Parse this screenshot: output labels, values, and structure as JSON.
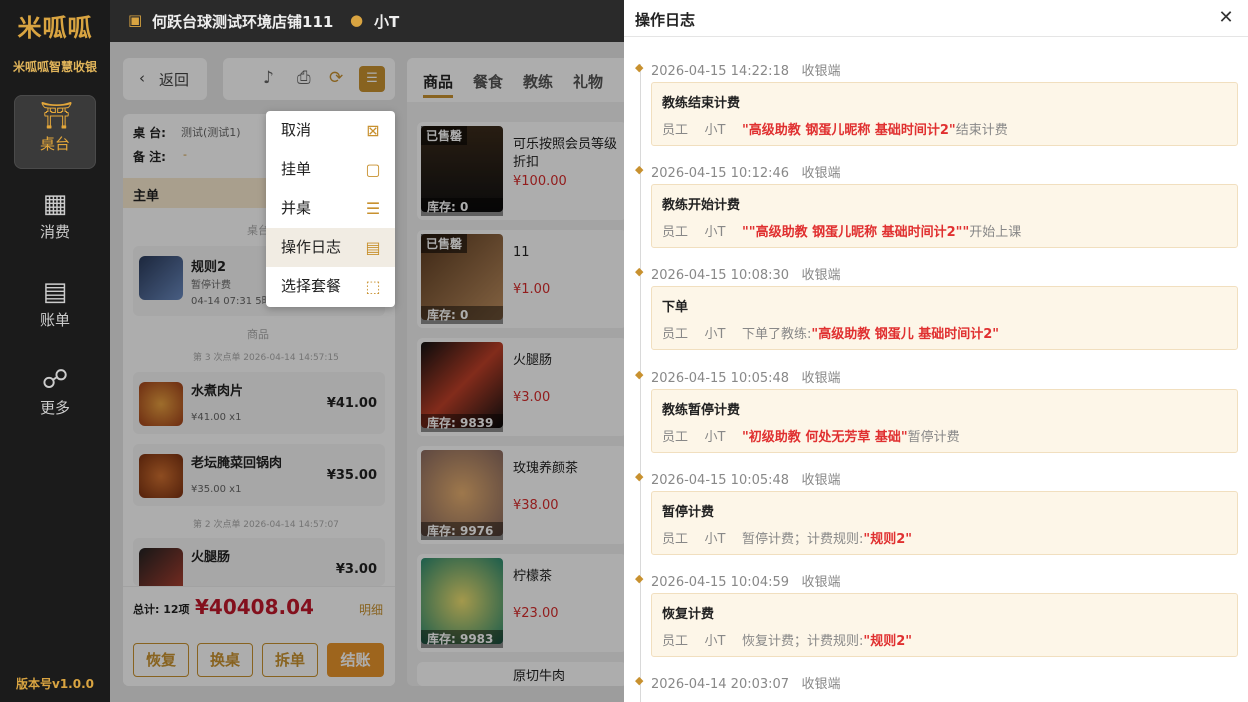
{
  "app": {
    "logo": "米呱呱",
    "brand": "米呱呱智慧收银",
    "version": "版本号v1.0.0"
  },
  "nav": [
    {
      "label": "桌台"
    },
    {
      "label": "消费"
    },
    {
      "label": "账单"
    },
    {
      "label": "更多"
    }
  ],
  "topbar": {
    "store": "何跃台球测试环境店铺111",
    "user": "小T"
  },
  "left": {
    "back": "返回",
    "table_label": "桌 台:",
    "table_value": "测试(测试1)",
    "note_label": "备 注:",
    "note_value": "-",
    "main_order": "主单",
    "sec_table": "桌台",
    "sec_goods": "商品",
    "rule_name": "规则2",
    "rule_status": "暂停计费",
    "rule_time": "04-14 07:31 5时",
    "batch3": "第 3 次点单 2026-04-14 14:57:15",
    "batch2": "第 2 次点单 2026-04-14 14:57:07",
    "dishes": [
      {
        "name": "水煮肉片",
        "sub": "¥41.00 x1",
        "price": "¥41.00"
      },
      {
        "name": "老坛腌菜回锅肉",
        "sub": "¥35.00 x1",
        "price": "¥35.00"
      },
      {
        "name": "火腿肠",
        "sub": "",
        "price": "¥3.00"
      }
    ],
    "total_label": "总计: 12项",
    "total_value": "¥40408.04",
    "detail": "明细",
    "buttons": [
      "恢复",
      "换桌",
      "拆单",
      "结账"
    ]
  },
  "tabs": [
    "商品",
    "餐食",
    "教练",
    "礼物"
  ],
  "products": [
    {
      "name": "可乐按照会员等级折扣",
      "price": "¥100.00",
      "stock": "库存: 0",
      "sold": "已售罄"
    },
    {
      "name": "11",
      "price": "¥1.00",
      "stock": "库存: 0",
      "sold": "已售罄"
    },
    {
      "name": "火腿肠",
      "price": "¥3.00",
      "stock": "库存: 9839",
      "sold": ""
    },
    {
      "name": "玫瑰养颜茶",
      "price": "¥38.00",
      "stock": "库存: 9976",
      "sold": ""
    },
    {
      "name": "柠檬茶",
      "price": "¥23.00",
      "stock": "库存: 9983",
      "sold": ""
    },
    {
      "name": "原切牛肉",
      "price": "",
      "stock": "",
      "sold": ""
    }
  ],
  "menu": [
    {
      "label": "取消",
      "icon": "cancel-icon"
    },
    {
      "label": "挂单",
      "icon": "clipboard-icon"
    },
    {
      "label": "并桌",
      "icon": "list-icon"
    },
    {
      "label": "操作日志",
      "icon": "log-icon"
    },
    {
      "label": "选择套餐",
      "icon": "chart-icon"
    }
  ],
  "panel": {
    "title": "操作日志",
    "logs": [
      {
        "time": "2026-04-15 14:22:18",
        "src": "收银端",
        "title": "教练结束计费",
        "role": "员工",
        "user": "小T",
        "pre": "",
        "hl": "\"高级助教 钢蛋儿昵称 基础时间计2\"",
        "post": "结束计费"
      },
      {
        "time": "2026-04-15 10:12:46",
        "src": "收银端",
        "title": "教练开始计费",
        "role": "员工",
        "user": "小T",
        "pre": "",
        "hl": "\"\"高级助教 钢蛋儿昵称 基础时间计2\"\"",
        "post": "开始上课"
      },
      {
        "time": "2026-04-15 10:08:30",
        "src": "收银端",
        "title": "下单",
        "role": "员工",
        "user": "小T",
        "pre": "下单了教练:",
        "hl": "\"高级助教 钢蛋儿 基础时间计2\"",
        "post": ""
      },
      {
        "time": "2026-04-15 10:05:48",
        "src": "收银端",
        "title": "教练暂停计费",
        "role": "员工",
        "user": "小T",
        "pre": "",
        "hl": "\"初级助教 何处无芳草 基础\"",
        "post": "暂停计费"
      },
      {
        "time": "2026-04-15 10:05:48",
        "src": "收银端",
        "title": "暂停计费",
        "role": "员工",
        "user": "小T",
        "pre": "暂停计费；计费规则:",
        "hl": "\"规则2\"",
        "post": ""
      },
      {
        "time": "2026-04-15 10:04:59",
        "src": "收银端",
        "title": "恢复计费",
        "role": "员工",
        "user": "小T",
        "pre": "恢复计费；计费规则:",
        "hl": "\"规则2\"",
        "post": ""
      },
      {
        "time": "2026-04-14 20:03:07",
        "src": "收银端",
        "title": "",
        "role": "",
        "user": "",
        "pre": "",
        "hl": "",
        "post": ""
      }
    ]
  }
}
